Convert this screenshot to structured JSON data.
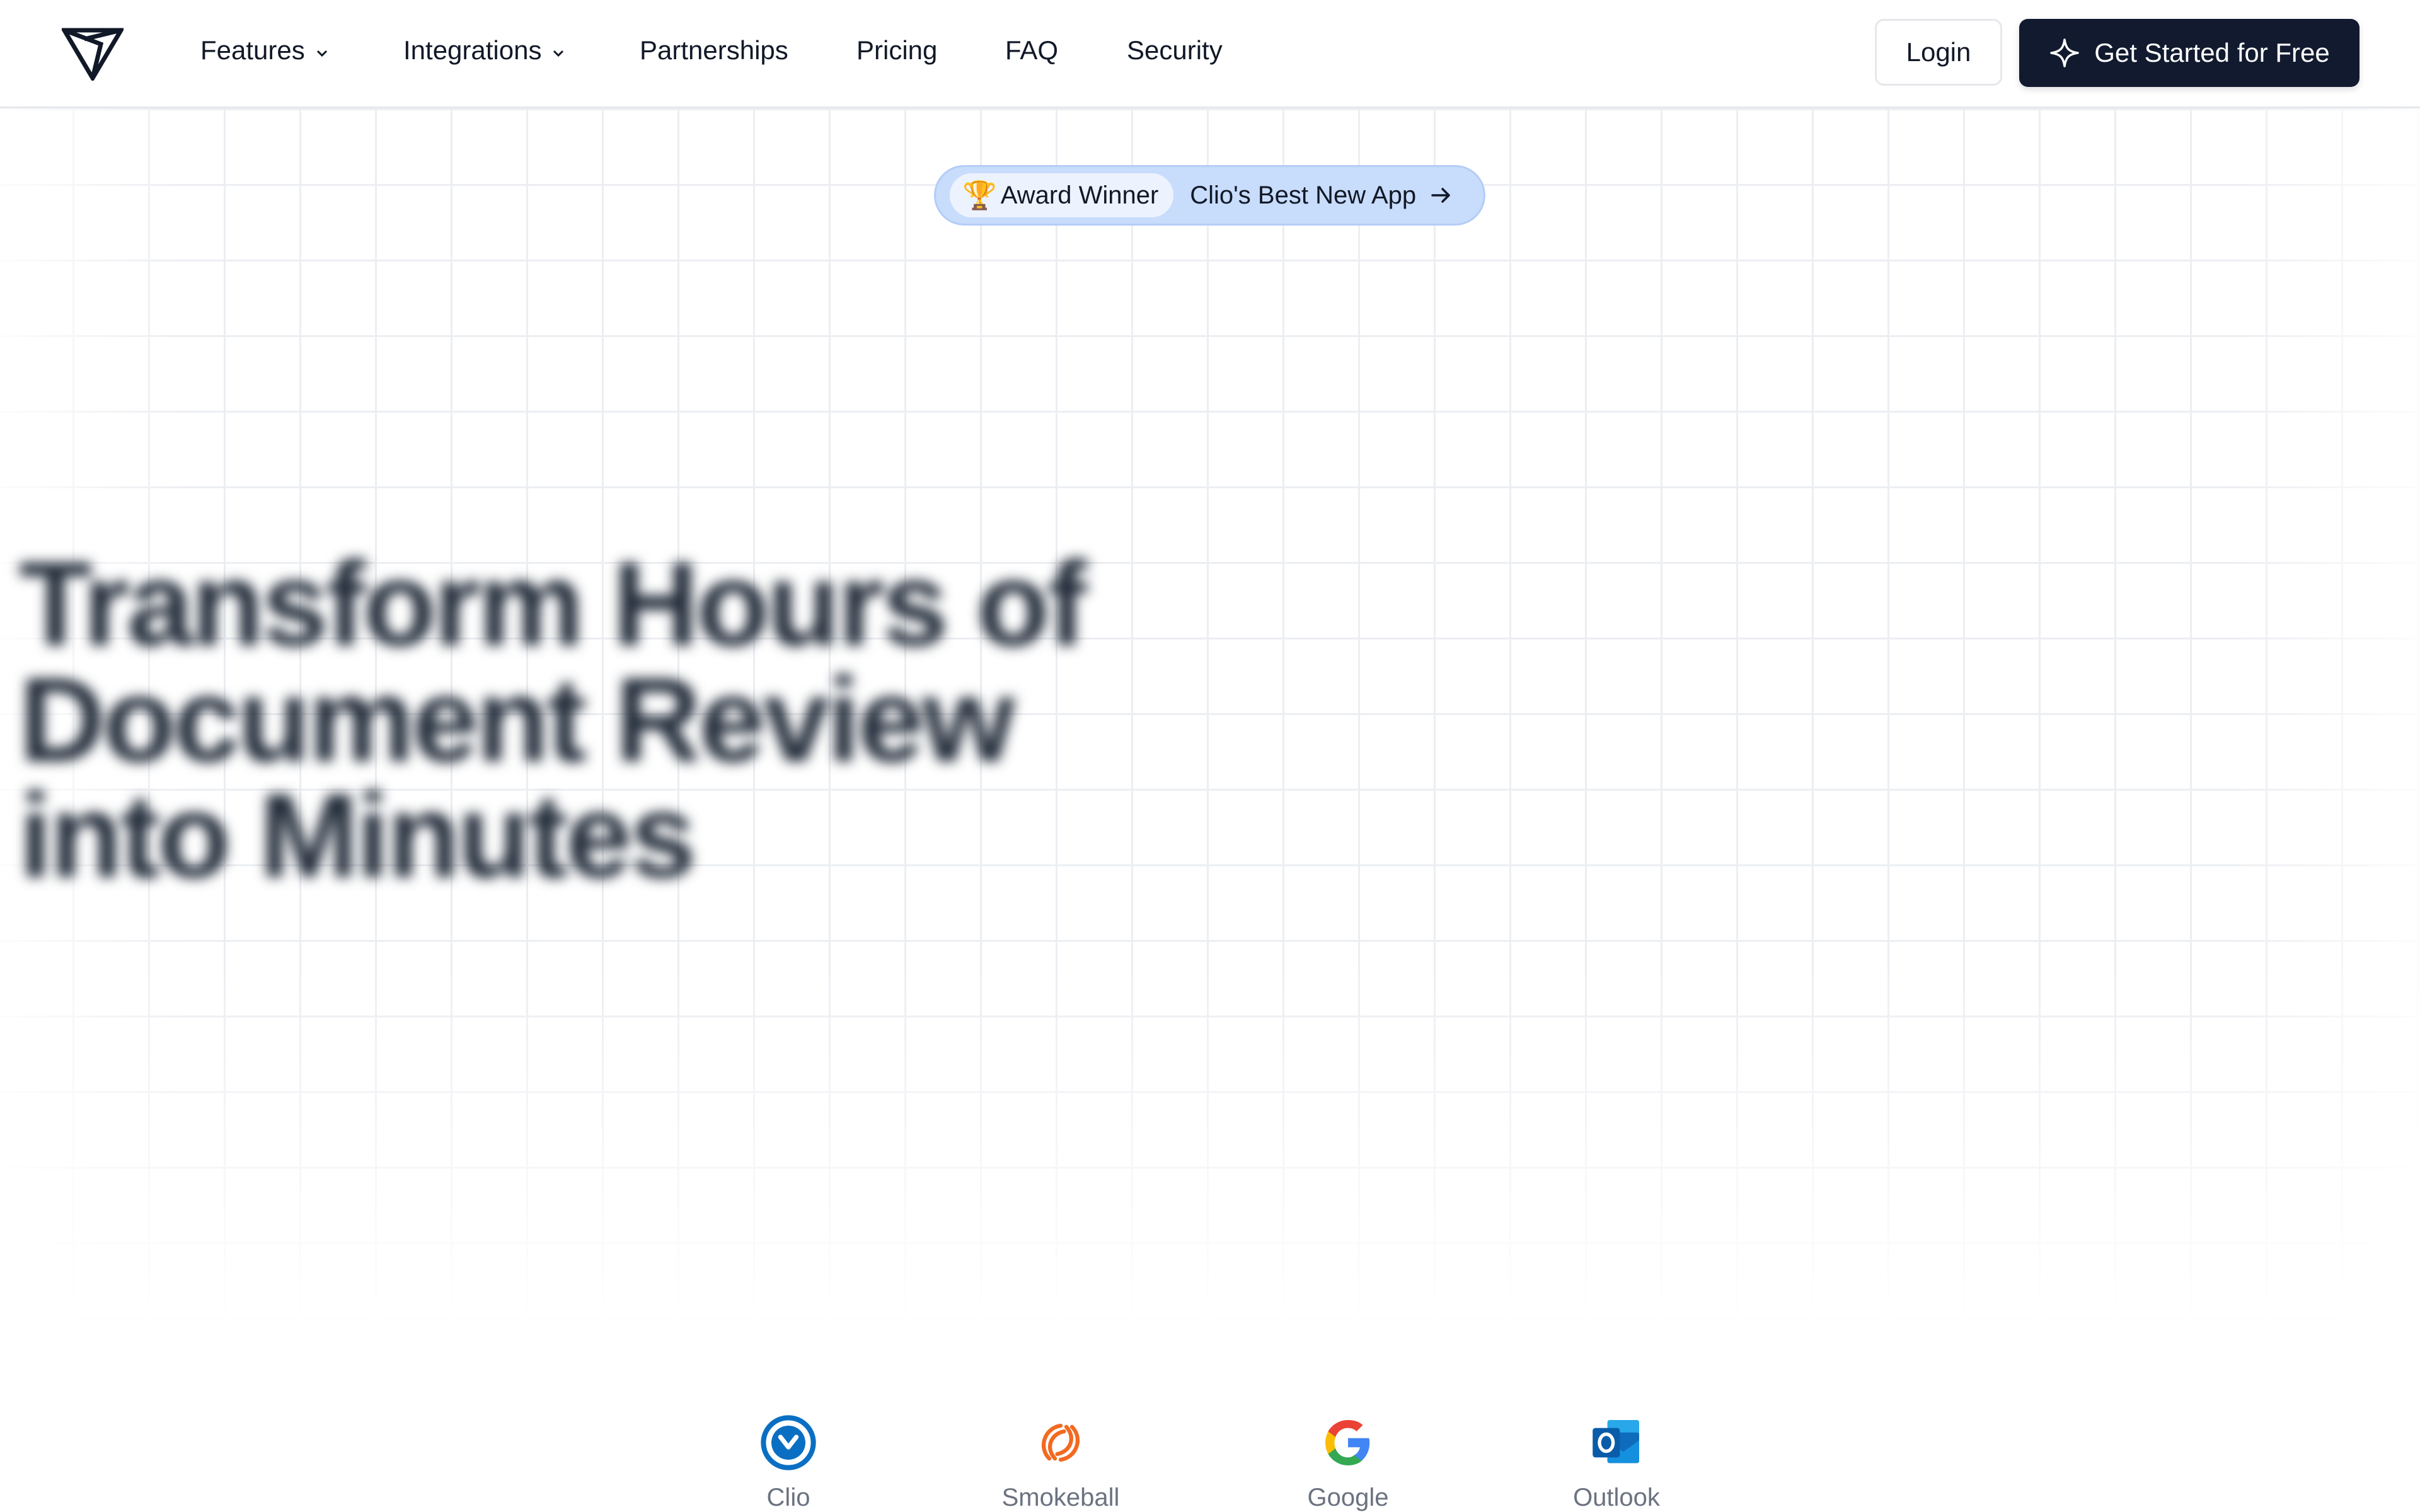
{
  "nav": {
    "logo_icon": "triangle-logo-icon",
    "links": [
      {
        "label": "Features",
        "has_dropdown": true
      },
      {
        "label": "Integrations",
        "has_dropdown": true
      },
      {
        "label": "Partnerships",
        "has_dropdown": false
      },
      {
        "label": "Pricing",
        "has_dropdown": false
      },
      {
        "label": "FAQ",
        "has_dropdown": false
      },
      {
        "label": "Security",
        "has_dropdown": false
      }
    ],
    "login_label": "Login",
    "cta_label": "Get Started for Free",
    "cta_icon": "sparkle-icon"
  },
  "hero": {
    "award": {
      "badge_emoji": "🏆",
      "badge_label": "Award Winner",
      "text": "Clio's Best New App",
      "arrow_icon": "arrow-right-icon"
    },
    "headline": "Transform Hours of Document Review into Minutes"
  },
  "integrations": [
    {
      "name": "Clio",
      "icon": "clio-icon"
    },
    {
      "name": "Smokeball",
      "icon": "smokeball-icon"
    },
    {
      "name": "Google",
      "icon": "google-icon"
    },
    {
      "name": "Outlook",
      "icon": "outlook-icon"
    }
  ],
  "colors": {
    "cta_bg": "#111a2e",
    "award_pill_bg": "#c8dcfb",
    "grid_line": "#eceef2",
    "clio_blue": "#0a6fc2",
    "smokeball_orange": "#f26a21",
    "outlook_blue": "#0f6cbd"
  }
}
